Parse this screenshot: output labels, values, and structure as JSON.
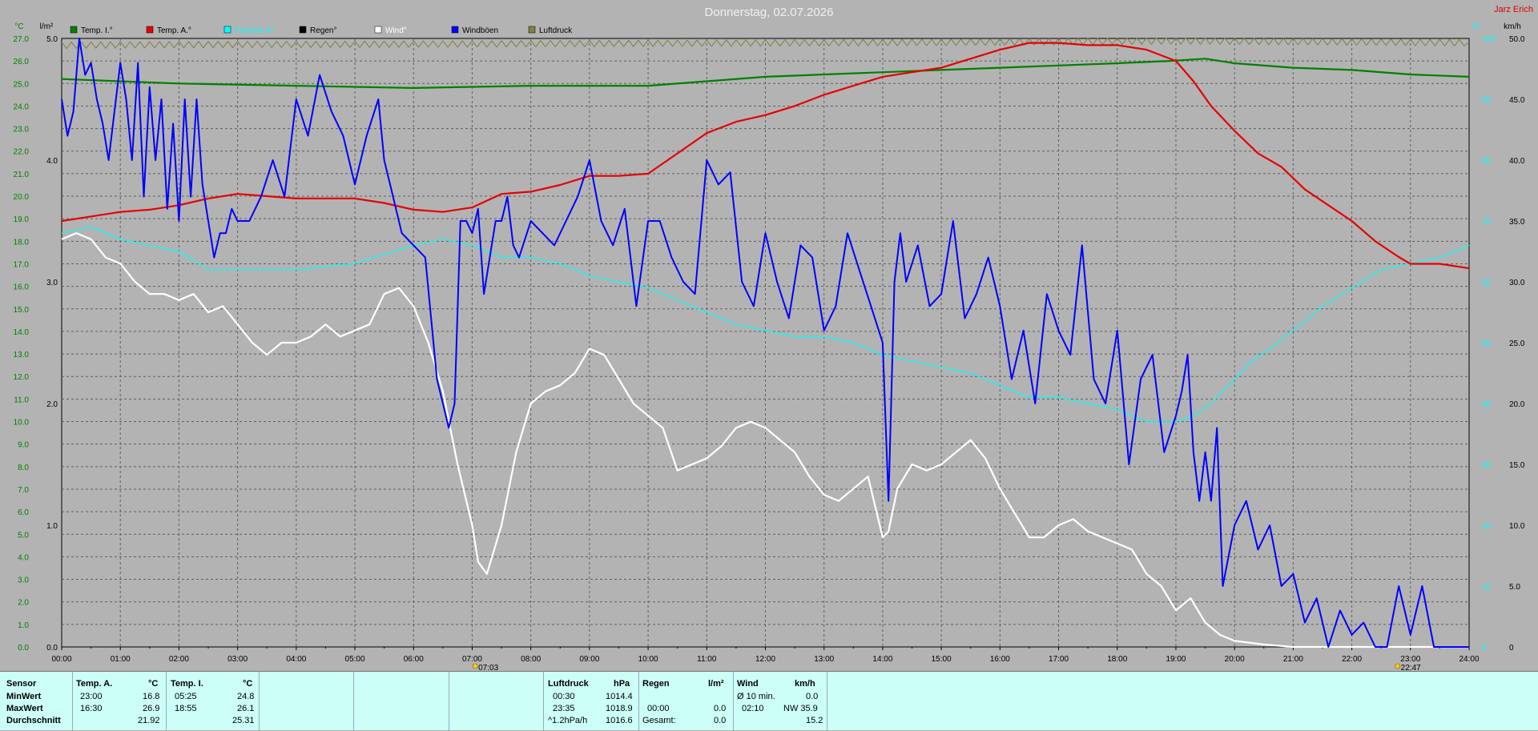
{
  "title": "Donnerstag, 02.07.2026",
  "credit": "Jarz Erich",
  "axes": {
    "left_unit_temp": "°C",
    "left_unit_rain": "l/m²",
    "right_unit_pct": "%",
    "right_unit_wind": "km/h"
  },
  "legend": [
    {
      "label": "Temp. I.°",
      "color": "#008000"
    },
    {
      "label": "Temp. A.°",
      "color": "#e60000"
    },
    {
      "label": "Feuchte A°",
      "color": "#00ffff"
    },
    {
      "label": "Regen°",
      "color": "#000000"
    },
    {
      "label": "Wind°",
      "color": "#ffffff"
    },
    {
      "label": "Windböen",
      "color": "#0000ff"
    },
    {
      "label": "Luftdruck",
      "color": "#808040"
    }
  ],
  "sun_markers": [
    {
      "time": "07:03",
      "x_hour": 7.05
    },
    {
      "time": "22:47",
      "x_hour": 22.78
    }
  ],
  "chart_data": {
    "type": "line",
    "title": "Donnerstag, 02.07.2026",
    "x_range": [
      0,
      24
    ],
    "x_ticks": [
      "00:00",
      "01:00",
      "02:00",
      "03:00",
      "04:00",
      "05:00",
      "06:00",
      "07:00",
      "08:00",
      "09:00",
      "10:00",
      "11:00",
      "12:00",
      "13:00",
      "14:00",
      "15:00",
      "16:00",
      "17:00",
      "18:00",
      "19:00",
      "20:00",
      "21:00",
      "22:00",
      "23:00",
      "24:00"
    ],
    "temp_axis": {
      "range": [
        0,
        27
      ],
      "ticks": [
        "0.0",
        "1.0",
        "2.0",
        "3.0",
        "4.0",
        "5.0",
        "6.0",
        "7.0",
        "8.0",
        "9.0",
        "10.0",
        "11.0",
        "12.0",
        "13.0",
        "14.0",
        "15.0",
        "16.0",
        "17.0",
        "18.0",
        "19.0",
        "20.0",
        "21.0",
        "22.0",
        "23.0",
        "24.0",
        "25.0",
        "26.0",
        "27.0"
      ]
    },
    "rain_axis": {
      "range": [
        0,
        5
      ],
      "ticks": [
        "0.0",
        "1.0",
        "2.0",
        "3.0",
        "4.0",
        "5.0"
      ]
    },
    "pct_axis": {
      "range": [
        0,
        100
      ],
      "ticks": [
        "0",
        "10",
        "20",
        "30",
        "40",
        "50",
        "60",
        "70",
        "80",
        "90",
        "100"
      ]
    },
    "wind_axis": {
      "range": [
        0,
        50
      ],
      "ticks": [
        "0",
        "5.0",
        "10.0",
        "15.0",
        "20.0",
        "25.0",
        "30.0",
        "35.0",
        "40.0",
        "45.0",
        "50.0"
      ]
    },
    "grid": true,
    "series": [
      {
        "name": "Temp. I.°",
        "axis": "temp",
        "color": "#008000",
        "x": [
          0,
          2,
          4,
          6,
          8,
          10,
          11,
          12,
          13,
          14,
          15,
          16,
          17,
          18,
          18.9,
          19.5,
          20,
          21,
          22,
          23,
          24
        ],
        "y": [
          25.2,
          25.0,
          24.9,
          24.8,
          24.9,
          24.9,
          25.1,
          25.3,
          25.4,
          25.5,
          25.6,
          25.7,
          25.8,
          25.9,
          26.0,
          26.1,
          25.9,
          25.7,
          25.6,
          25.4,
          25.3
        ]
      },
      {
        "name": "Temp. A.°",
        "axis": "temp",
        "color": "#e60000",
        "x": [
          0,
          0.5,
          1,
          1.5,
          2,
          2.5,
          3,
          3.5,
          4,
          4.5,
          5,
          5.5,
          6,
          6.5,
          7,
          7.5,
          8,
          8.5,
          9,
          9.5,
          10,
          10.5,
          11,
          11.5,
          12,
          12.5,
          13,
          13.5,
          14,
          14.5,
          15,
          15.5,
          16,
          16.5,
          17,
          17.5,
          18,
          18.5,
          19,
          19.3,
          19.6,
          20,
          20.4,
          20.8,
          21.2,
          21.6,
          22,
          22.4,
          22.8,
          23,
          23.5,
          24
        ],
        "y": [
          18.9,
          19.1,
          19.3,
          19.4,
          19.6,
          19.9,
          20.1,
          20.0,
          19.9,
          19.9,
          19.9,
          19.7,
          19.4,
          19.3,
          19.5,
          20.1,
          20.2,
          20.5,
          20.9,
          20.9,
          21.0,
          21.9,
          22.8,
          23.3,
          23.6,
          24.0,
          24.5,
          24.9,
          25.3,
          25.5,
          25.7,
          26.1,
          26.5,
          26.8,
          26.8,
          26.7,
          26.7,
          26.5,
          26.0,
          25.1,
          24.0,
          22.9,
          21.9,
          21.3,
          20.3,
          19.6,
          18.9,
          18.0,
          17.3,
          17.0,
          17.0,
          16.8
        ]
      },
      {
        "name": "Feuchte A°",
        "axis": "pct",
        "color": "#00ffff",
        "x": [
          0,
          0.5,
          1,
          2,
          2.5,
          3,
          3.5,
          4,
          5,
          6,
          6.5,
          7,
          7.5,
          8,
          8.5,
          9,
          9.5,
          10,
          10.5,
          11,
          11.5,
          12,
          12.5,
          13,
          13.5,
          14,
          14.5,
          15,
          15.5,
          16,
          16.5,
          17,
          17.5,
          18,
          18.5,
          19,
          19.3,
          19.6,
          20,
          20.3,
          20.6,
          21,
          21.5,
          22,
          22.5,
          23,
          23.5,
          24
        ],
        "y": [
          68,
          69,
          67,
          65,
          62,
          62,
          62,
          62,
          63,
          66,
          67,
          66,
          64,
          64,
          63,
          61,
          60,
          59,
          57,
          55,
          53,
          52,
          51,
          51,
          50,
          48,
          47,
          46,
          45,
          43,
          41,
          41,
          40,
          39,
          37,
          37,
          38,
          40,
          44,
          47,
          49,
          52,
          56,
          59,
          62,
          63,
          64,
          66
        ]
      },
      {
        "name": "Wind°",
        "axis": "wind",
        "color": "#ffffff",
        "x": [
          0,
          0.25,
          0.5,
          0.75,
          1,
          1.25,
          1.5,
          1.75,
          2,
          2.25,
          2.5,
          2.75,
          3,
          3.25,
          3.5,
          3.75,
          4,
          4.25,
          4.5,
          4.75,
          5,
          5.25,
          5.5,
          5.75,
          6,
          6.25,
          6.5,
          6.75,
          7,
          7.1,
          7.25,
          7.5,
          7.75,
          8,
          8.25,
          8.5,
          8.75,
          9,
          9.25,
          9.5,
          9.75,
          10,
          10.25,
          10.5,
          10.75,
          11,
          11.25,
          11.5,
          11.75,
          12,
          12.25,
          12.5,
          12.75,
          13,
          13.25,
          13.5,
          13.75,
          14,
          14.1,
          14.25,
          14.5,
          14.75,
          15,
          15.25,
          15.5,
          15.75,
          16,
          16.25,
          16.5,
          16.75,
          17,
          17.25,
          17.5,
          17.75,
          18,
          18.25,
          18.5,
          18.75,
          19,
          19.25,
          19.5,
          19.75,
          20,
          20.5,
          21,
          21.5,
          22,
          22.5,
          23,
          23.5,
          24
        ],
        "y": [
          33.5,
          34,
          33.5,
          32,
          31.5,
          30,
          29,
          29,
          28.5,
          29,
          27.5,
          28,
          26.5,
          25,
          24,
          25,
          25,
          25.5,
          26.5,
          25.5,
          26,
          26.5,
          29,
          29.5,
          28,
          25,
          21,
          15,
          10,
          7,
          6,
          10,
          16,
          20,
          21,
          21.5,
          22.5,
          24.5,
          24,
          22,
          20,
          19,
          18,
          14.5,
          15,
          15.5,
          16.5,
          18,
          18.5,
          18,
          17,
          16,
          14,
          12.5,
          12,
          13,
          14,
          9,
          9.5,
          13,
          15,
          14.5,
          15,
          16,
          17,
          15.5,
          13,
          11,
          9,
          9,
          10,
          10.5,
          9.5,
          9,
          8.5,
          8,
          6,
          5,
          3,
          4,
          2,
          1,
          0.5,
          0.2,
          0,
          0,
          0,
          0,
          0,
          0,
          0
        ]
      },
      {
        "name": "Windböen",
        "axis": "wind",
        "color": "#0000ff",
        "x": [
          0,
          0.1,
          0.2,
          0.3,
          0.4,
          0.5,
          0.6,
          0.7,
          0.8,
          0.9,
          1.0,
          1.1,
          1.2,
          1.3,
          1.4,
          1.5,
          1.6,
          1.7,
          1.8,
          1.9,
          2.0,
          2.1,
          2.2,
          2.3,
          2.4,
          2.5,
          2.6,
          2.7,
          2.8,
          2.9,
          3.0,
          3.2,
          3.4,
          3.6,
          3.8,
          4.0,
          4.2,
          4.4,
          4.6,
          4.8,
          5.0,
          5.2,
          5.4,
          5.5,
          5.6,
          5.7,
          5.8,
          6.0,
          6.2,
          6.4,
          6.5,
          6.6,
          6.7,
          6.8,
          6.9,
          7.0,
          7.1,
          7.2,
          7.3,
          7.4,
          7.5,
          7.6,
          7.7,
          7.8,
          8.0,
          8.2,
          8.4,
          8.6,
          8.8,
          9.0,
          9.2,
          9.4,
          9.6,
          9.8,
          10.0,
          10.2,
          10.4,
          10.6,
          10.8,
          11.0,
          11.2,
          11.4,
          11.6,
          11.8,
          12.0,
          12.2,
          12.4,
          12.6,
          12.8,
          13.0,
          13.2,
          13.4,
          13.6,
          13.8,
          14.0,
          14.1,
          14.2,
          14.3,
          14.4,
          14.6,
          14.8,
          15.0,
          15.2,
          15.4,
          15.6,
          15.8,
          16.0,
          16.2,
          16.4,
          16.6,
          16.8,
          17.0,
          17.2,
          17.4,
          17.6,
          17.8,
          18.0,
          18.2,
          18.4,
          18.6,
          18.8,
          19.0,
          19.1,
          19.2,
          19.3,
          19.4,
          19.5,
          19.6,
          19.7,
          19.8,
          20.0,
          20.2,
          20.4,
          20.6,
          20.8,
          21.0,
          21.2,
          21.4,
          21.6,
          21.8,
          22.0,
          22.2,
          22.4,
          22.6,
          22.8,
          23.0,
          23.2,
          23.4,
          23.6,
          23.8,
          24.0
        ],
        "y": [
          45,
          42,
          44,
          50,
          47,
          48,
          45,
          43,
          40,
          44,
          48,
          45,
          40,
          48,
          37,
          46,
          40,
          45,
          36,
          43,
          35,
          45,
          37,
          45,
          38,
          35,
          32,
          34,
          34,
          36,
          35,
          35,
          37,
          40,
          37,
          45,
          42,
          47,
          44,
          42,
          38,
          42,
          45,
          40,
          38,
          36,
          34,
          33,
          32,
          22,
          20,
          18,
          20,
          35,
          35,
          34,
          36,
          29,
          32,
          35,
          35,
          37,
          33,
          32,
          35,
          34,
          33,
          35,
          37,
          40,
          35,
          33,
          36,
          28,
          35,
          35,
          32,
          30,
          29,
          40,
          38,
          39,
          30,
          28,
          34,
          30,
          27,
          33,
          32,
          26,
          28,
          34,
          31,
          28,
          25,
          12,
          30,
          34,
          30,
          33,
          28,
          29,
          35,
          27,
          29,
          32,
          28,
          22,
          26,
          20,
          29,
          26,
          24,
          33,
          22,
          20,
          26,
          15,
          22,
          24,
          16,
          19,
          21,
          24,
          16,
          12,
          16,
          12,
          18,
          5,
          10,
          12,
          8,
          10,
          5,
          6,
          2,
          4,
          0,
          3,
          1,
          2,
          0,
          0,
          5,
          1,
          5,
          0,
          0,
          0,
          0
        ]
      },
      {
        "name": "Luftdruck",
        "axis": "pressure",
        "color": "#808040",
        "x": [
          0,
          1,
          2,
          3,
          4,
          5,
          6,
          7,
          8,
          9,
          10,
          11,
          12,
          13,
          14,
          15,
          16,
          17,
          18,
          19,
          20,
          21,
          22,
          23,
          24
        ],
        "y": [
          1014.4,
          1014.8,
          1015.0,
          1015.2,
          1015.3,
          1015.4,
          1015.6,
          1015.8,
          1016.0,
          1016.2,
          1016.4,
          1016.6,
          1016.8,
          1017.0,
          1017.2,
          1017.4,
          1017.8,
          1018.2,
          1018.6,
          1018.9,
          1018.6,
          1018.2,
          1017.8,
          1017.4,
          1017.0
        ]
      }
    ]
  },
  "footer": {
    "sensor": "Sensor",
    "row_labels": [
      "MinWert",
      "MaxWert",
      "Durchschnitt"
    ],
    "temp_a": {
      "header": "Temp. A.",
      "unit": "°C",
      "min_time": "23:00",
      "min": "16.8",
      "max_time": "16:30",
      "max": "26.9",
      "avg": "21.92"
    },
    "temp_i": {
      "header": "Temp. I.",
      "unit": "°C",
      "min_time": "05:25",
      "min": "24.8",
      "max_time": "18:55",
      "max": "26.1",
      "avg": "25.31"
    },
    "pressure": {
      "header": "Luftdruck",
      "unit": "hPa",
      "min_time": "00:30",
      "min": "1014.4",
      "max_time": "23:35",
      "max": "1018.9",
      "trend_label": "^1.2hPa/h",
      "avg": "1016.6"
    },
    "rain": {
      "header": "Regen",
      "unit": "l/m²",
      "max_time": "00:00",
      "max": "0.0",
      "total_label": "Gesamt:",
      "total": "0.0"
    },
    "wind": {
      "header": "Wind",
      "unit": "km/h",
      "min_label": "Ø 10 min.",
      "min": "0.0",
      "max_time": "02:10",
      "max": "NW 35.9",
      "avg": "15.2"
    }
  }
}
